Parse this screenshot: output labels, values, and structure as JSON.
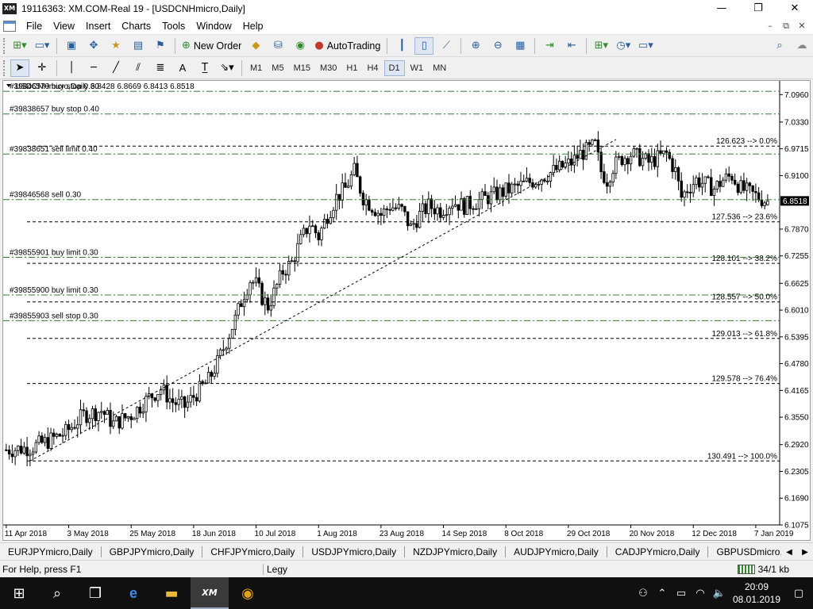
{
  "window": {
    "logo": "XM",
    "title": "19116363: XM.COM-Real 19 - [USDCNHmicro,Daily]",
    "min_glyph": "—",
    "max_glyph": "❐",
    "close_glyph": "✕"
  },
  "menu": {
    "items": [
      "File",
      "View",
      "Insert",
      "Charts",
      "Tools",
      "Window",
      "Help"
    ],
    "mdi": [
      "–",
      "⧉",
      "✕"
    ]
  },
  "toolbar": {
    "new_order": "New Order",
    "autotrading": "AutoTrading",
    "timeframes": [
      "M1",
      "M5",
      "M15",
      "M30",
      "H1",
      "H4",
      "D1",
      "W1",
      "MN"
    ],
    "active_timeframe": "D1"
  },
  "chart": {
    "header": "USDCNHmicro,Daily  6.8428 6.8669 6.8413 6.8518",
    "current_price": "6.8518",
    "colors": {
      "order_line": "#2e7d32",
      "fib_line": "#000000",
      "bull_candle": "#ffffff",
      "bear_candle": "#000000",
      "price_tag_bg": "#000000"
    }
  },
  "chart_data": {
    "type": "candlestick",
    "symbol": "USDCNHmicro",
    "timeframe": "Daily",
    "ohlc_last": {
      "open": 6.8428,
      "high": 6.8669,
      "low": 6.8413,
      "close": 6.8518
    },
    "ylim": [
      6.1075,
      7.1275
    ],
    "y_ticks": [
      "7.0960",
      "7.0330",
      "6.9715",
      "6.9100",
      "6.8518",
      "6.7870",
      "6.7255",
      "6.6625",
      "6.6010",
      "6.5395",
      "6.4780",
      "6.4165",
      "6.3550",
      "6.2920",
      "6.2305",
      "6.1690",
      "6.1075"
    ],
    "x_ticks": [
      "11 Apr 2018",
      "3 May 2018",
      "25 May 2018",
      "18 Jun 2018",
      "10 Jul 2018",
      "1 Aug 2018",
      "23 Aug 2018",
      "14 Sep 2018",
      "8 Oct 2018",
      "29 Oct 2018",
      "20 Nov 2018",
      "12 Dec 2018",
      "7 Jan 2019"
    ],
    "close_path": [
      [
        0,
        6.28
      ],
      [
        8,
        6.285
      ],
      [
        14,
        6.3
      ],
      [
        20,
        6.32
      ],
      [
        26,
        6.36
      ],
      [
        32,
        6.37
      ],
      [
        36,
        6.34
      ],
      [
        42,
        6.36
      ],
      [
        48,
        6.4
      ],
      [
        52,
        6.42
      ],
      [
        56,
        6.39
      ],
      [
        60,
        6.38
      ],
      [
        64,
        6.41
      ],
      [
        68,
        6.44
      ],
      [
        71,
        6.48
      ],
      [
        74,
        6.53
      ],
      [
        77,
        6.58
      ],
      [
        80,
        6.64
      ],
      [
        82,
        6.67
      ],
      [
        84,
        6.66
      ],
      [
        86,
        6.63
      ],
      [
        88,
        6.61
      ],
      [
        90,
        6.64
      ],
      [
        93,
        6.69
      ],
      [
        96,
        6.71
      ],
      [
        99,
        6.76
      ],
      [
        102,
        6.8
      ],
      [
        105,
        6.77
      ],
      [
        108,
        6.82
      ],
      [
        111,
        6.86
      ],
      [
        114,
        6.88
      ],
      [
        117,
        6.92
      ],
      [
        120,
        6.86
      ],
      [
        123,
        6.84
      ],
      [
        126,
        6.82
      ],
      [
        129,
        6.84
      ],
      [
        133,
        6.83
      ],
      [
        136,
        6.79
      ],
      [
        139,
        6.82
      ],
      [
        142,
        6.84
      ],
      [
        146,
        6.83
      ],
      [
        150,
        6.85
      ],
      [
        154,
        6.84
      ],
      [
        158,
        6.85
      ],
      [
        162,
        6.86
      ],
      [
        166,
        6.87
      ],
      [
        170,
        6.88
      ],
      [
        174,
        6.89
      ],
      [
        178,
        6.9
      ],
      [
        181,
        6.91
      ],
      [
        184,
        6.92
      ],
      [
        187,
        6.93
      ],
      [
        190,
        6.94
      ],
      [
        193,
        6.96
      ],
      [
        196,
        6.97
      ],
      [
        198,
        6.98
      ],
      [
        200,
        6.92
      ],
      [
        202,
        6.9
      ],
      [
        204,
        6.93
      ],
      [
        207,
        6.95
      ],
      [
        210,
        6.96
      ],
      [
        213,
        6.95
      ],
      [
        216,
        6.94
      ],
      [
        219,
        6.95
      ],
      [
        222,
        6.96
      ],
      [
        225,
        6.92
      ],
      [
        227,
        6.86
      ],
      [
        229,
        6.88
      ],
      [
        232,
        6.9
      ],
      [
        235,
        6.89
      ],
      [
        238,
        6.88
      ],
      [
        241,
        6.9
      ],
      [
        244,
        6.91
      ],
      [
        247,
        6.88
      ],
      [
        250,
        6.87
      ],
      [
        253,
        6.86
      ],
      [
        256,
        6.85
      ]
    ],
    "trendline": {
      "from": {
        "bar": 8,
        "price": 6.2545
      },
      "to": {
        "bar": 205,
        "price": 6.9928
      }
    },
    "fibonacci": {
      "levels": [
        {
          "label": "126.623 --> 0.0%",
          "price": 6.9778
        },
        {
          "label": "127.536 --> 23.6%",
          "price": 6.8038
        },
        {
          "label": "128.101 --> 38.2%",
          "price": 6.7083
        },
        {
          "label": "128.557 --> 50.0%",
          "price": 6.6198
        },
        {
          "label": "129.013 --> 61.8%",
          "price": 6.5359
        },
        {
          "label": "129.578 --> 76.4%",
          "price": 6.4324
        },
        {
          "label": "130.491 --> 100.0%",
          "price": 6.2545
        }
      ]
    },
    "orders": [
      {
        "label": "#39846570 buy stop 0.30",
        "price": 7.1035
      },
      {
        "label": "#39838657 buy stop 0.40",
        "price": 7.0515
      },
      {
        "label": "#39838651 sell limit 0.40",
        "price": 6.9595
      },
      {
        "label": "#39846568 sell 0.30",
        "price": 6.8548
      },
      {
        "label": "#39855901 buy limit 0.30",
        "price": 6.7223
      },
      {
        "label": "#39855900 buy limit 0.30",
        "price": 6.6357
      },
      {
        "label": "#39855903 sell stop 0.30",
        "price": 6.5768
      }
    ]
  },
  "tabs": [
    "EURJPYmicro,Daily",
    "GBPJPYmicro,Daily",
    "CHFJPYmicro,Daily",
    "USDJPYmicro,Daily",
    "NZDJPYmicro,Daily",
    "AUDJPYmicro,Daily",
    "CADJPYmicro,Daily",
    "GBPUSDmicro,Daily"
  ],
  "status": {
    "help": "For Help, press F1",
    "profile": "Legy",
    "connection": "34/1 kb"
  },
  "taskbar": {
    "time": "20:09",
    "date": "08.01.2019"
  }
}
